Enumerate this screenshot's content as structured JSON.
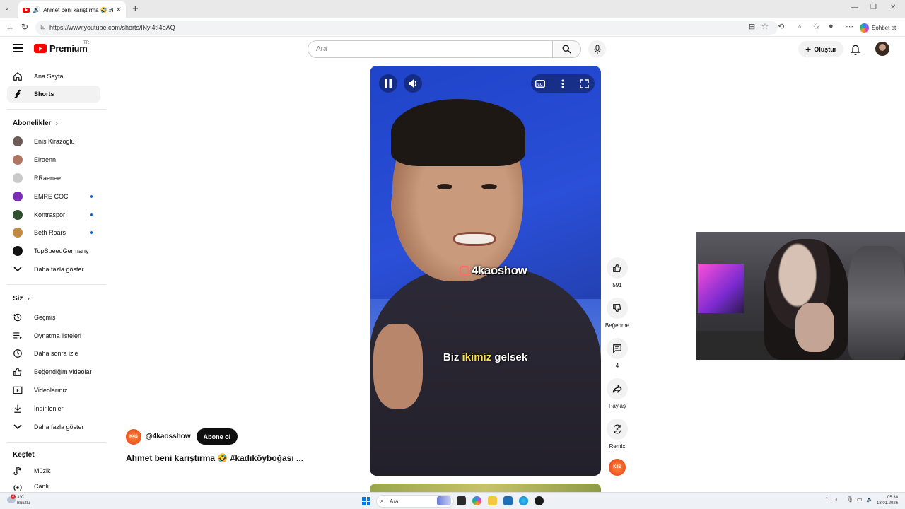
{
  "browser": {
    "tab_title": "Ahmet beni karıştırma 🤣 #ka",
    "url": "https://www.youtube.com/shorts/lNyi4tI4oAQ",
    "copilot_label": "Sohbet et"
  },
  "header": {
    "logo_text": "Premium",
    "country": "TR",
    "search_placeholder": "Ara",
    "create_label": "Oluştur"
  },
  "sidebar": {
    "main": [
      {
        "label": "Ana Sayfa",
        "icon": "home-icon"
      },
      {
        "label": "Shorts",
        "icon": "shorts-icon",
        "active": true
      }
    ],
    "subscriptions_heading": "Abonelikler",
    "subscriptions": [
      {
        "label": "Enis Kirazoglu",
        "color": "#6b5a55",
        "live": false
      },
      {
        "label": "Elraenn",
        "color": "#b07560",
        "live": false
      },
      {
        "label": "RRaenee",
        "color": "#c9c9c9",
        "live": false
      },
      {
        "label": "EMRE COC",
        "color": "#7b2bb5",
        "live": true
      },
      {
        "label": "Kontraspor",
        "color": "#2f4f2f",
        "live": true
      },
      {
        "label": "Beth Roars",
        "color": "#c08a45",
        "live": true
      },
      {
        "label": "TopSpeedGermany",
        "color": "#111111",
        "live": false
      }
    ],
    "subscriptions_more": "Daha fazla göster",
    "you_heading": "Siz",
    "you": [
      {
        "label": "Geçmiş",
        "icon": "history-icon"
      },
      {
        "label": "Oynatma listeleri",
        "icon": "playlists-icon"
      },
      {
        "label": "Daha sonra izle",
        "icon": "watch-later-icon"
      },
      {
        "label": "Beğendiğim videolar",
        "icon": "liked-icon"
      },
      {
        "label": "Videolarınız",
        "icon": "your-videos-icon"
      },
      {
        "label": "İndirilenler",
        "icon": "downloads-icon"
      }
    ],
    "you_more": "Daha fazla göster",
    "explore_heading": "Keşfet",
    "explore": [
      {
        "label": "Müzik",
        "icon": "music-icon"
      },
      {
        "label": "Canlı",
        "icon": "live-icon"
      }
    ]
  },
  "video": {
    "watermark": "4kaoshow",
    "caption_pre": "Biz ",
    "caption_hl": "ikimiz",
    "caption_post": " gelsek",
    "channel_handle": "@4kaosshow",
    "channel_avatar_text": "K4S",
    "subscribe_label": "Abone ol",
    "title": "Ahmet beni karıştırma 🤣 #kadıköyboğası ..."
  },
  "actions": {
    "like_count": "591",
    "dislike_label": "Beğenme",
    "comment_count": "4",
    "share_label": "Paylaş",
    "remix_label": "Remix"
  },
  "taskbar": {
    "weather_temp": "3°C",
    "weather_desc": "Bulutlu",
    "notification_count": "3",
    "search_label": "Ara",
    "time": "05:38",
    "date": "18.01.2026"
  }
}
